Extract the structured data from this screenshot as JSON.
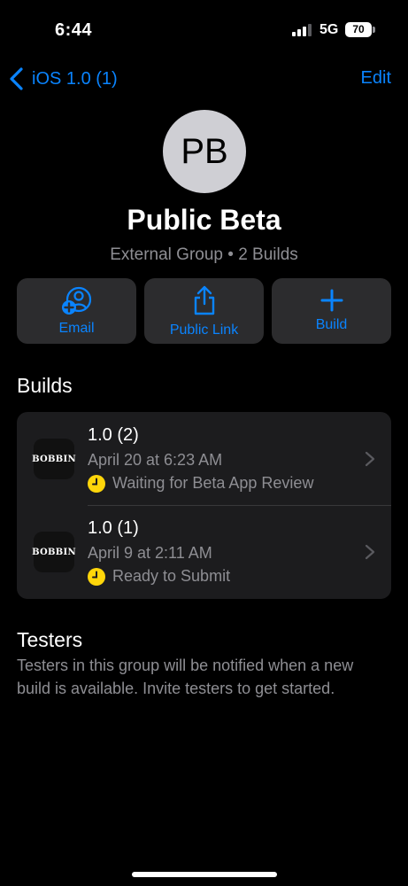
{
  "status_bar": {
    "time": "6:44",
    "network": "5G",
    "battery": "70"
  },
  "nav": {
    "back_label": "iOS 1.0 (1)",
    "edit_label": "Edit"
  },
  "group": {
    "initials": "PB",
    "title": "Public Beta",
    "subtitle": "External Group • 2 Builds"
  },
  "actions": [
    {
      "label": "Email",
      "icon": "add-person-icon"
    },
    {
      "label": "Public Link",
      "icon": "share-icon"
    },
    {
      "label": "Build",
      "icon": "plus-icon"
    }
  ],
  "builds": {
    "title": "Builds",
    "items": [
      {
        "app_name": "BOBBIN",
        "version": "1.0 (2)",
        "date": "April 20 at 6:23 AM",
        "status": "Waiting for Beta App Review"
      },
      {
        "app_name": "BOBBIN",
        "version": "1.0 (1)",
        "date": "April 9 at 2:11 AM",
        "status": "Ready to Submit"
      }
    ]
  },
  "testers": {
    "title": "Testers",
    "description": "Testers in this group will be notified when a new build is available. Invite testers to get started."
  },
  "colors": {
    "accent": "#0a84ff",
    "status_pending": "#ffd60a",
    "card": "#2c2c2e",
    "list_bg": "#1c1c1e"
  }
}
